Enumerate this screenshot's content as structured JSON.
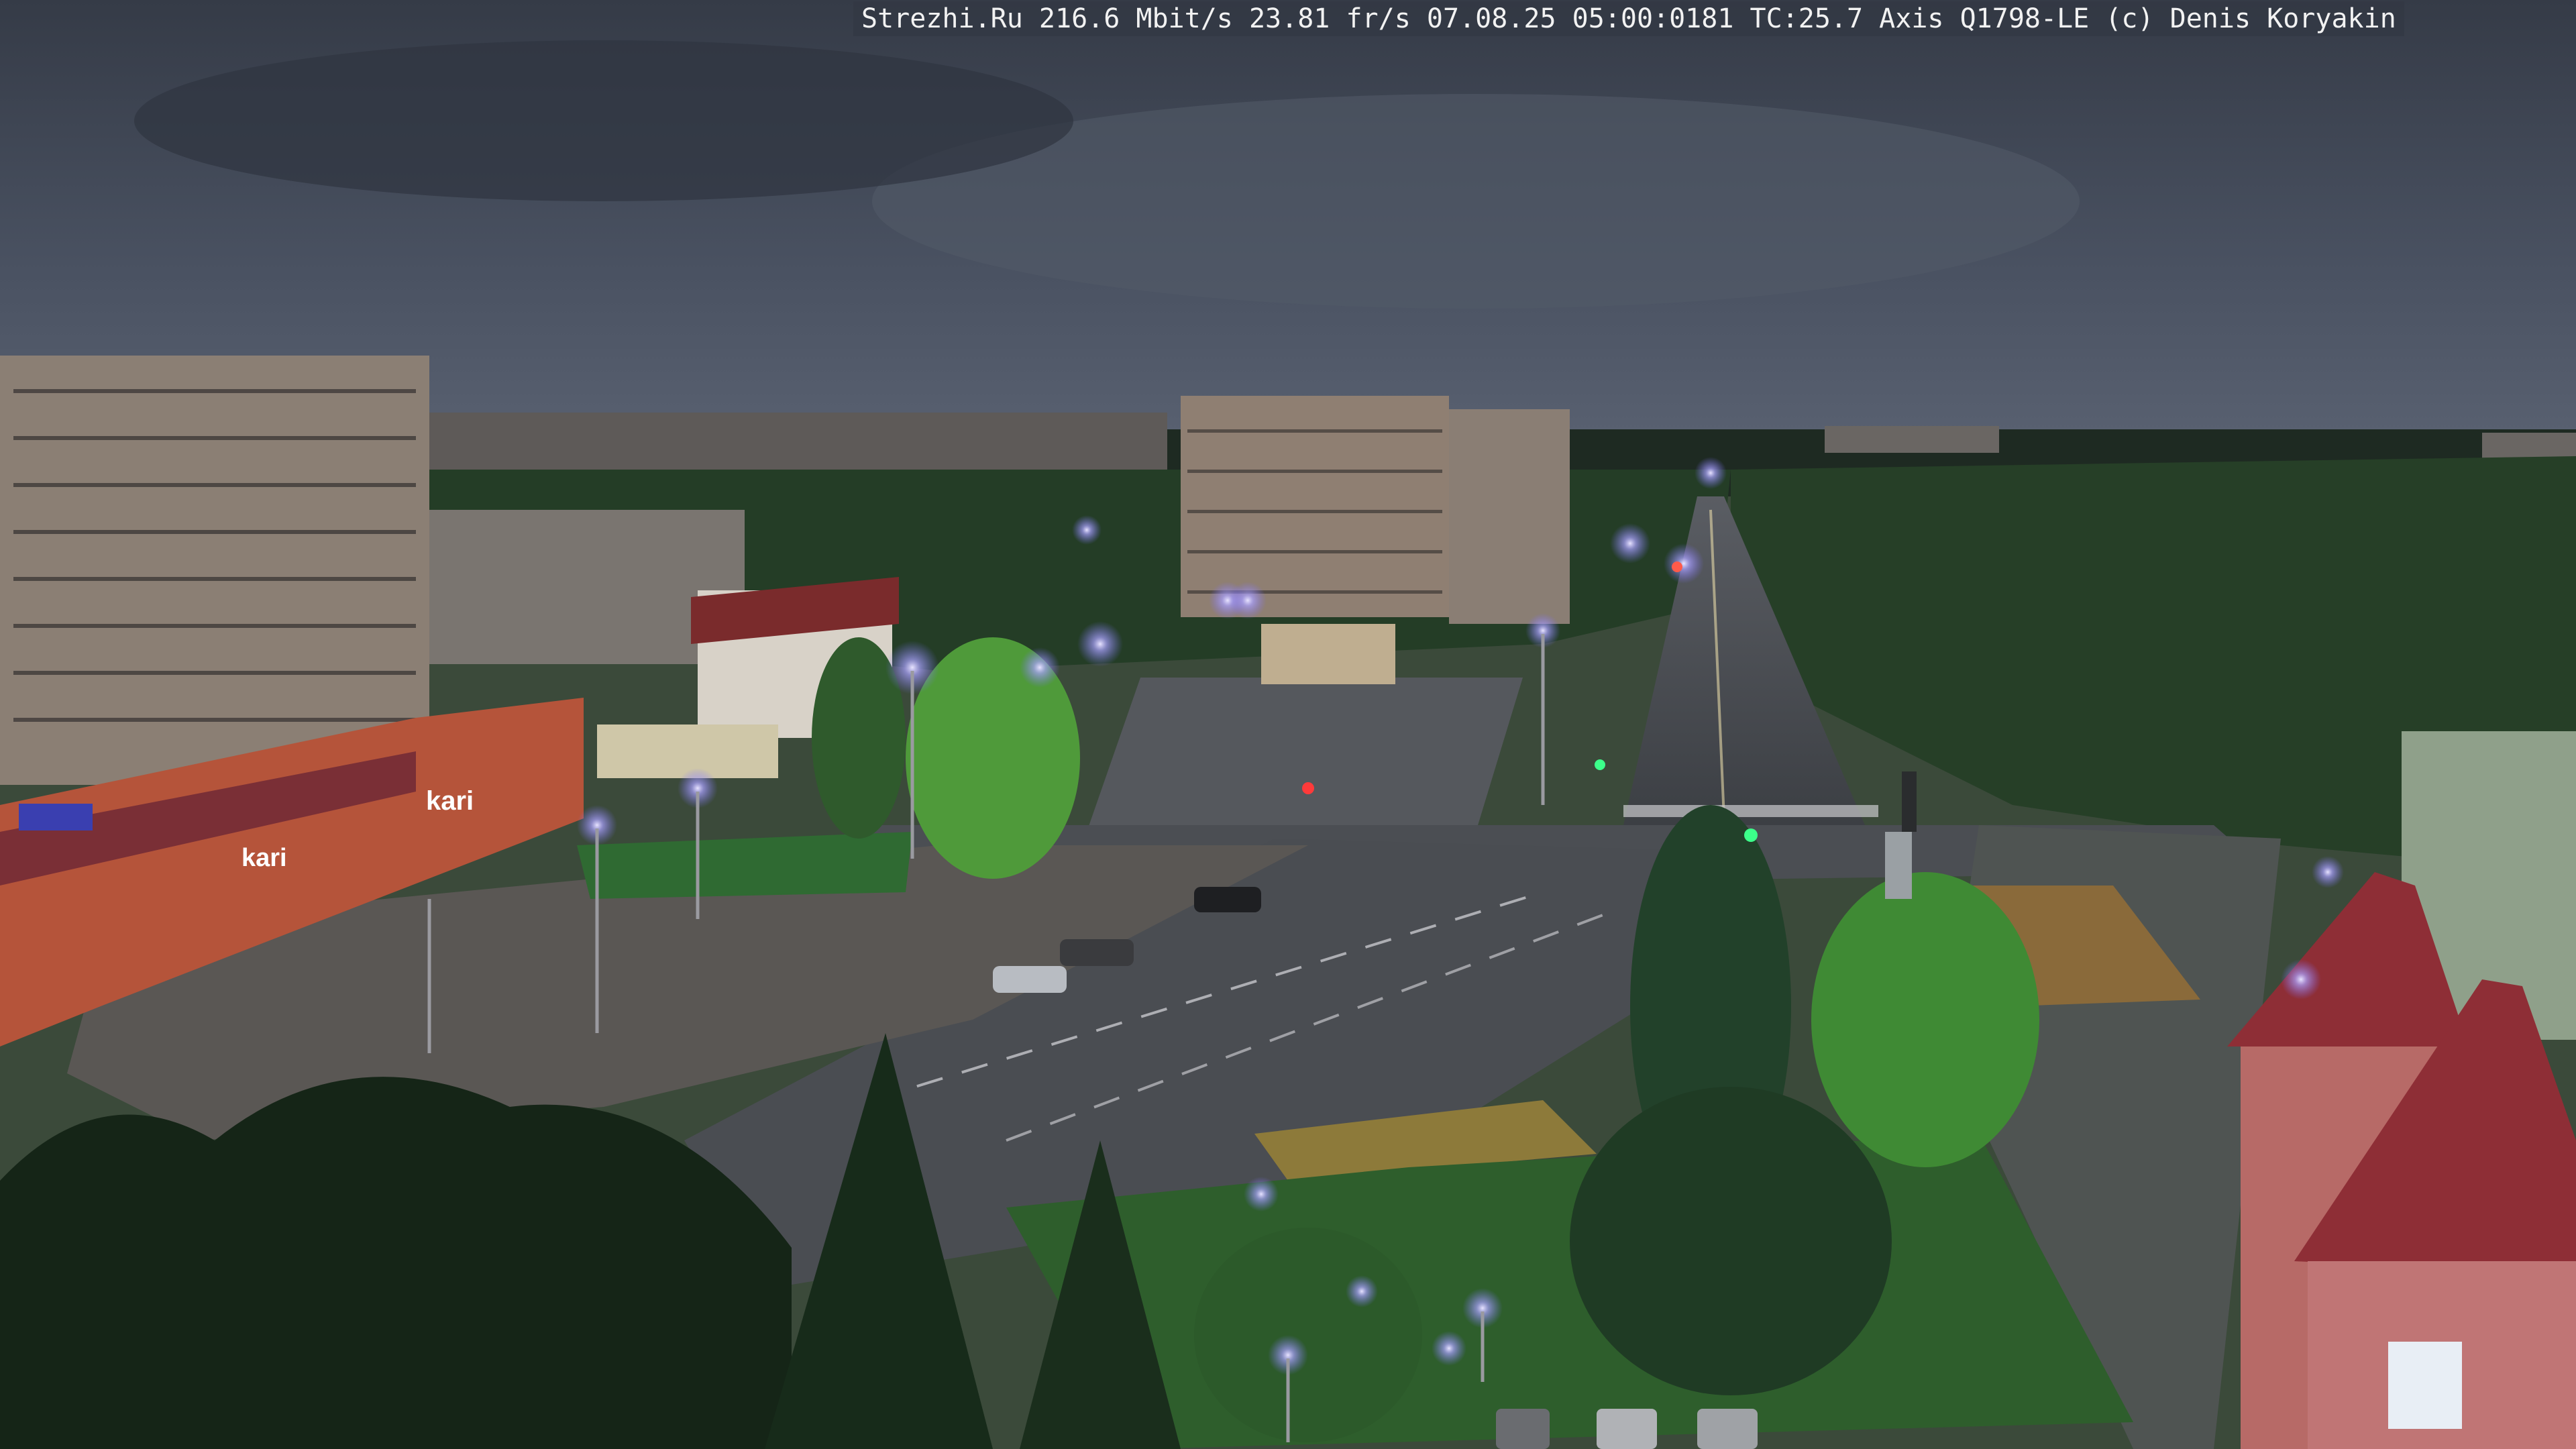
{
  "camera_overlay": {
    "text": "Strezhi.Ru 216.6 Mbit/s 23.81 fr/s 07.08.25 05:00:0181 TC:25.7  Axis Q1798-LE  (c) Denis Koryakin"
  },
  "storefront": {
    "sign_main": "kari",
    "sign_side": "kari"
  },
  "colors": {
    "sky": "#3a4250",
    "trees": "#1f3a22",
    "road": "#4a4d52",
    "street_light": "#b9b4ff"
  }
}
